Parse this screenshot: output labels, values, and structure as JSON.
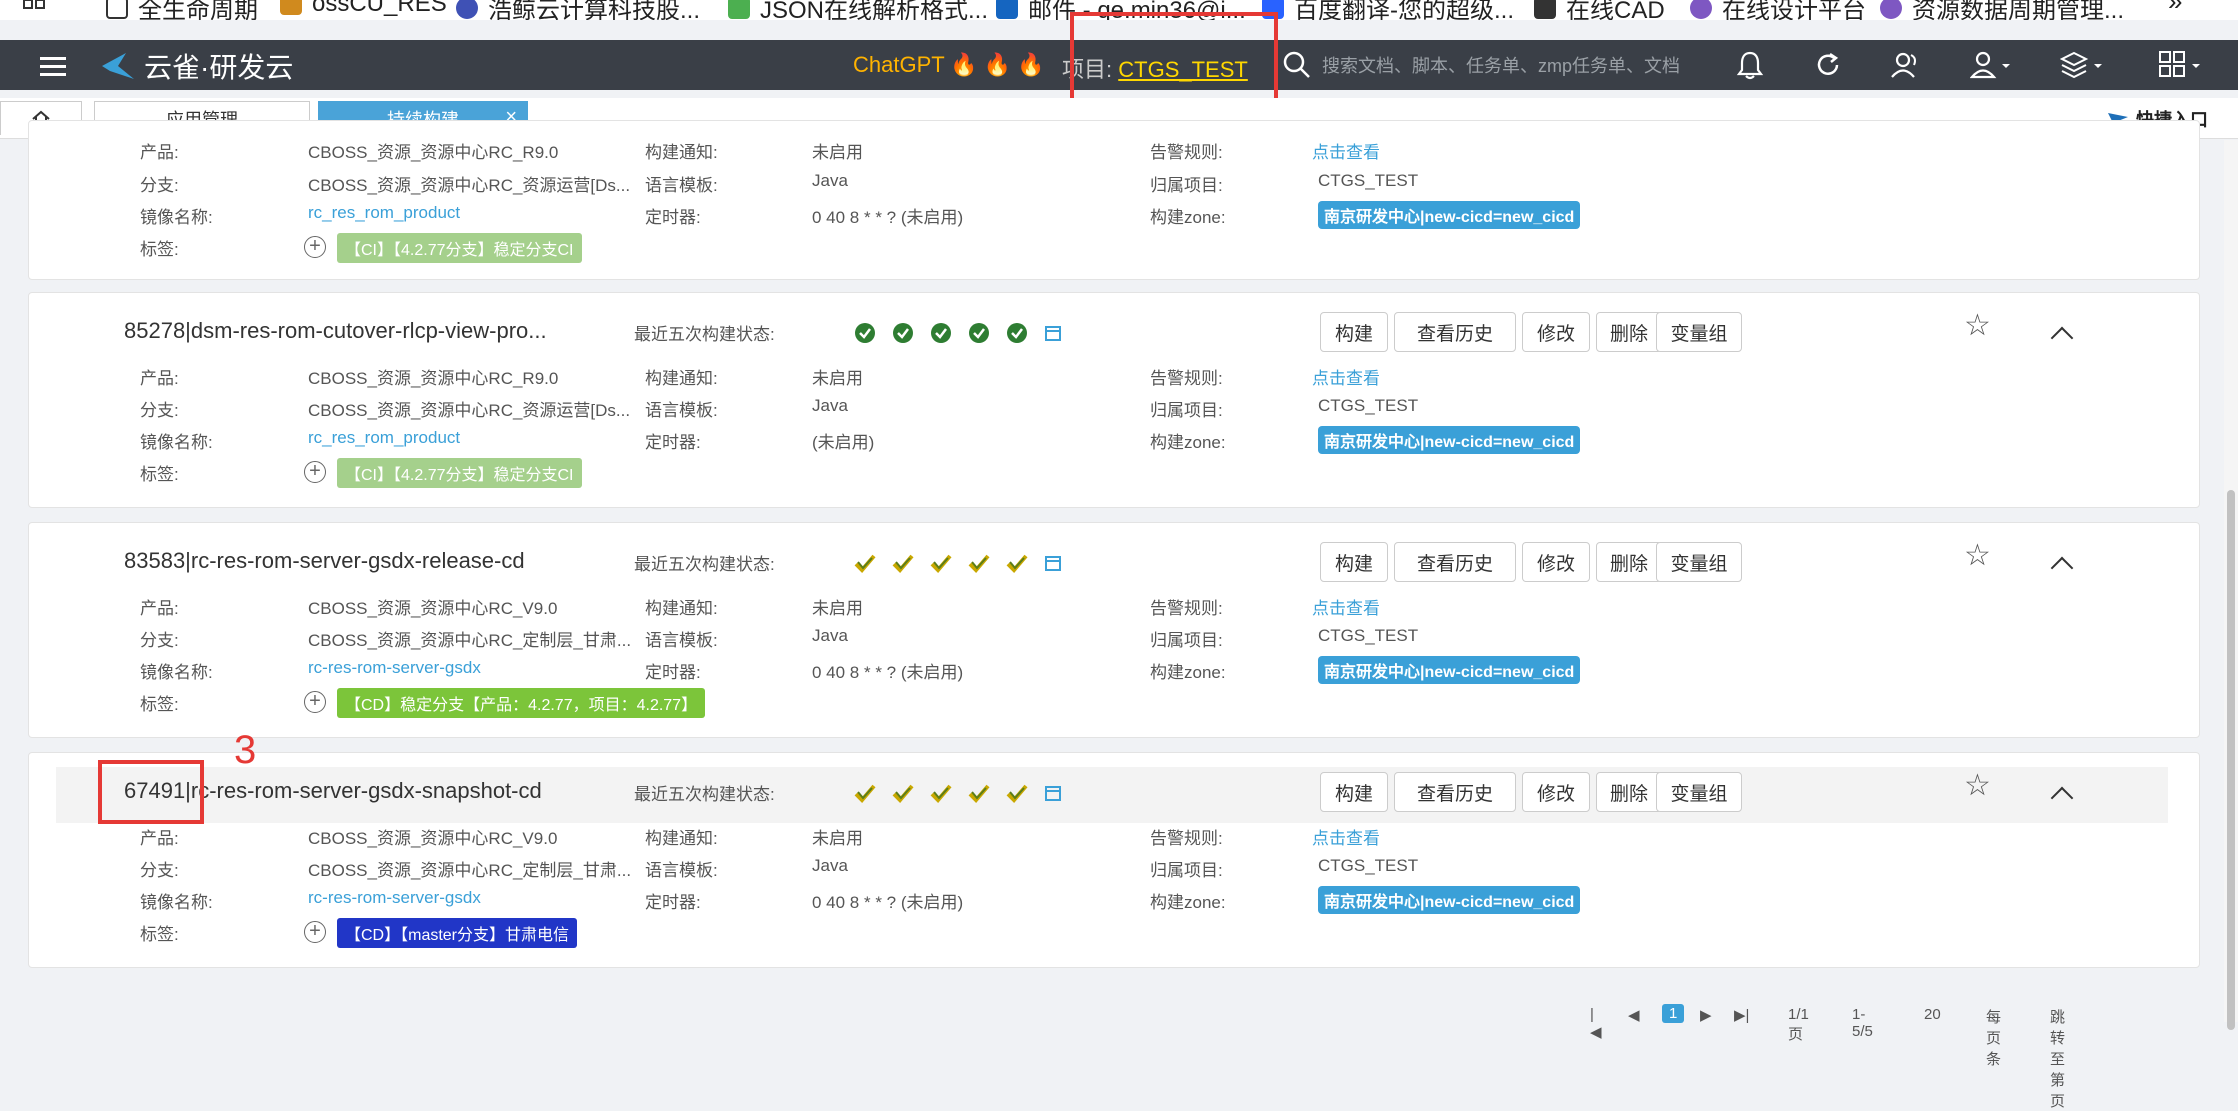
{
  "bookmarks": [
    {
      "label": "全生命周期",
      "icon": "square-icon"
    },
    {
      "label": "ossCU_RES",
      "icon": "box-icon"
    },
    {
      "label": "浩鲸云计算科技股...",
      "icon": "globe-icon"
    },
    {
      "label": "JSON在线解析格式...",
      "icon": "json-icon"
    },
    {
      "label": "邮件 - qe.min36@i...",
      "icon": "mail-icon"
    },
    {
      "label": "百度翻译-您的超级...",
      "icon": "translate-icon"
    },
    {
      "label": "在线CAD",
      "icon": "cad-icon"
    },
    {
      "label": "在线设计平台",
      "icon": "design-icon"
    },
    {
      "label": "资源数据周期管理...",
      "icon": "design-icon"
    }
  ],
  "header": {
    "logo_text": "云雀·研发云",
    "chatgpt_label": "ChatGPT 🔥 🔥 🔥",
    "project_label": "项目:",
    "project_value": "CTGS_TEST",
    "search_placeholder": "搜索文档、脚本、任务单、zmp任务单、文档"
  },
  "tabs": [
    {
      "label": "应用管理"
    },
    {
      "label": "持续构建"
    }
  ],
  "quick_entry": "快捷入口",
  "annotation_number": "3",
  "labels": {
    "product": "产品:",
    "branch": "分支:",
    "image": "镜像名称:",
    "tags": "标签:",
    "notify": "构建通知:",
    "template": "语言模板:",
    "timer": "定时器:",
    "alert": "告警规则:",
    "belong": "归属项目:",
    "zone": "构建zone:",
    "recent_status": "最近五次构建状态:"
  },
  "buttons": {
    "build": "构建",
    "history": "查看历史",
    "edit": "修改",
    "delete": "删除",
    "vargroup": "变量组"
  },
  "cards": [
    {
      "product": "CBOSS_资源_资源中心RC_R9.0",
      "branch": "CBOSS_资源_资源中心RC_资源运营[Ds...",
      "image": "rc_res_rom_product",
      "notify": "未启用",
      "template": "Java",
      "timer": "0 40 8 * * ? (未启用)",
      "alert": "点击查看",
      "belong": "CTGS_TEST",
      "zone": "南京研发中心|new-cicd=new_cicd",
      "tag": "【CI】【4.2.77分支】稳定分支CI",
      "tag_color": "#a5d08c"
    },
    {
      "id_title": "85278|dsm-res-rom-cutover-rlcp-view-pro...",
      "status": "success",
      "product": "CBOSS_资源_资源中心RC_R9.0",
      "branch": "CBOSS_资源_资源中心RC_资源运营[Ds...",
      "image": "rc_res_rom_product",
      "notify": "未启用",
      "template": "Java",
      "timer": "(未启用)",
      "alert": "点击查看",
      "belong": "CTGS_TEST",
      "zone": "南京研发中心|new-cicd=new_cicd",
      "tag": "【CI】【4.2.77分支】稳定分支CI",
      "tag_color": "#a5d08c"
    },
    {
      "id_title": "83583|rc-res-rom-server-gsdx-release-cd",
      "status": "deploy",
      "product": "CBOSS_资源_资源中心RC_V9.0",
      "branch": "CBOSS_资源_资源中心RC_定制层_甘肃...",
      "image": "rc-res-rom-server-gsdx",
      "notify": "未启用",
      "template": "Java",
      "timer": "0 40 8 * * ? (未启用)",
      "alert": "点击查看",
      "belong": "CTGS_TEST",
      "zone": "南京研发中心|new-cicd=new_cicd",
      "tag": "【CD】稳定分支【产品：4.2.77，项目：4.2.77】",
      "tag_color": "#7cc53a"
    },
    {
      "id_title": "67491|rc-res-rom-server-gsdx-snapshot-cd",
      "status": "deploy",
      "product": "CBOSS_资源_资源中心RC_V9.0",
      "branch": "CBOSS_资源_资源中心RC_定制层_甘肃...",
      "image": "rc-res-rom-server-gsdx",
      "notify": "未启用",
      "template": "Java",
      "timer": "0 40 8 * * ? (未启用)",
      "alert": "点击查看",
      "belong": "CTGS_TEST",
      "zone": "南京研发中心|new-cicd=new_cicd",
      "tag": "【CD】【master分支】甘肃电信",
      "tag_color": "#2136c7"
    }
  ],
  "pagination": {
    "current_page": "1",
    "page_info": "1/1页",
    "range": "1-5/5",
    "page_size": "20",
    "per_page": "每页条",
    "jump": "跳转至第页"
  }
}
